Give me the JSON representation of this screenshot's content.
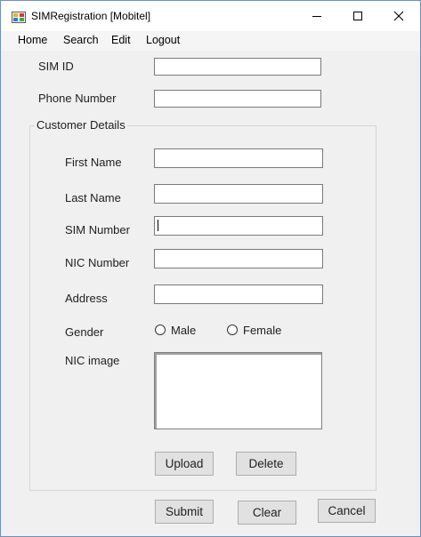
{
  "window": {
    "title": "SIMRegistration [Mobitel]"
  },
  "titlebar_buttons": {
    "minimize": "minimize-icon",
    "maximize": "maximize-icon",
    "close": "close-icon"
  },
  "menu": [
    "Home",
    "Search",
    "Edit",
    "Logout"
  ],
  "fields": {
    "sim_id": {
      "label": "SIM ID",
      "value": ""
    },
    "phone": {
      "label": "Phone Number",
      "value": ""
    }
  },
  "group": {
    "title": "Customer Details",
    "first_name": {
      "label": "First Name",
      "value": ""
    },
    "last_name": {
      "label": "Last Name",
      "value": ""
    },
    "sim_number": {
      "label": "SIM Number",
      "value": ""
    },
    "nic_number": {
      "label": "NIC Number",
      "value": ""
    },
    "address": {
      "label": "Address",
      "value": ""
    },
    "gender": {
      "label": "Gender",
      "options": [
        "Male",
        "Female"
      ]
    },
    "nic_image": {
      "label": "NIC image"
    },
    "upload": "Upload",
    "delete": "Delete"
  },
  "actions": {
    "submit": "Submit",
    "clear": "Clear",
    "cancel": "Cancel"
  }
}
